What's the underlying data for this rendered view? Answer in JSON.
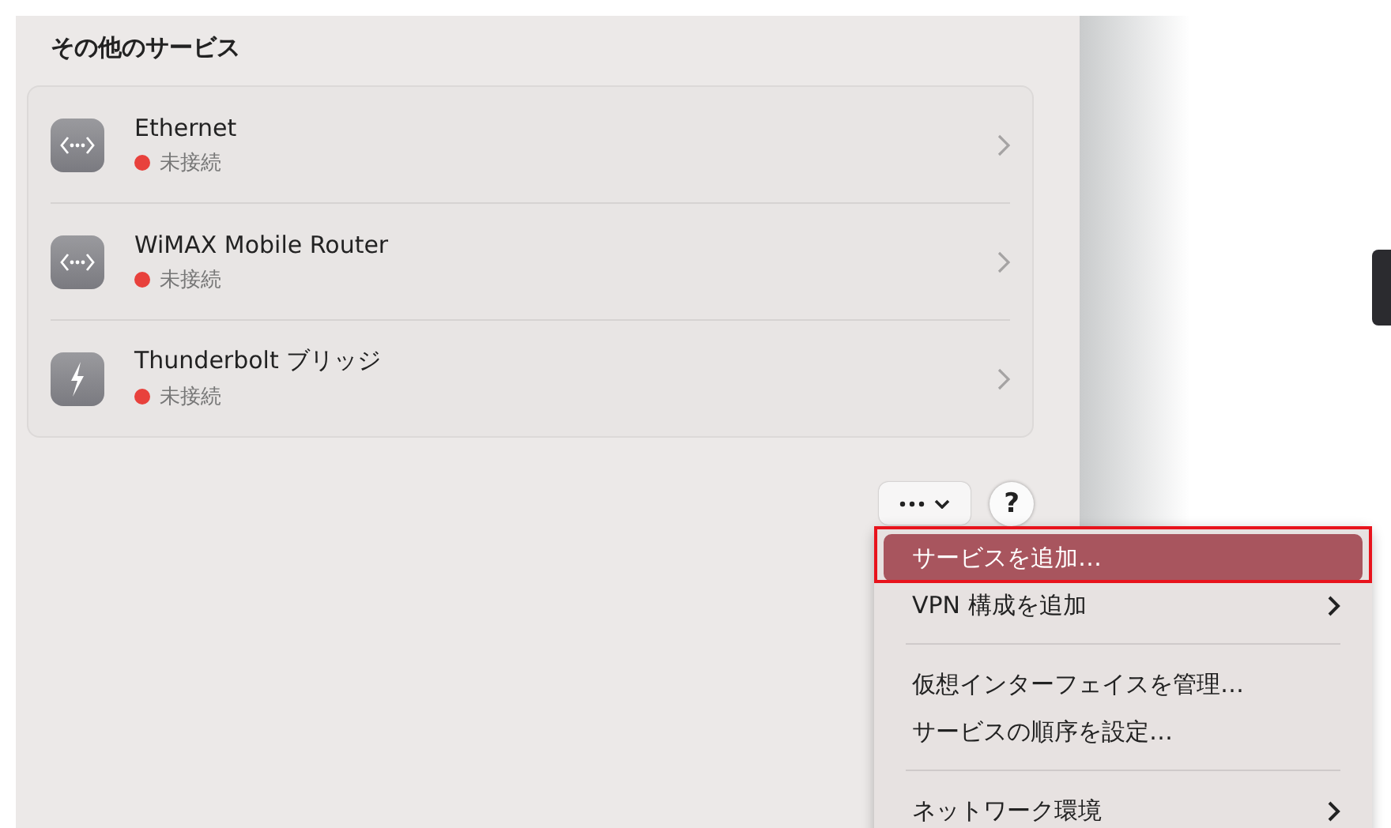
{
  "section_title": "その他のサービス",
  "services": [
    {
      "name": "Ethernet",
      "kind": "ethernet",
      "status": "未接続",
      "color": "#e8413c"
    },
    {
      "name": "WiMAX Mobile Router",
      "kind": "ethernet",
      "status": "未接続",
      "color": "#e8413c"
    },
    {
      "name": "Thunderbolt ブリッジ",
      "kind": "thunderbolt",
      "status": "未接続",
      "color": "#e8413c"
    }
  ],
  "help_button": "?",
  "menu": [
    {
      "kind": "item",
      "label": "サービスを追加…",
      "selected": true,
      "submenu": false
    },
    {
      "kind": "item",
      "label": "VPN 構成を追加",
      "selected": false,
      "submenu": true
    },
    {
      "kind": "separator"
    },
    {
      "kind": "item",
      "label": "仮想インターフェイスを管理…",
      "selected": false,
      "submenu": false
    },
    {
      "kind": "item",
      "label": "サービスの順序を設定…",
      "selected": false,
      "submenu": false
    },
    {
      "kind": "separator"
    },
    {
      "kind": "item",
      "label": "ネットワーク環境",
      "selected": false,
      "submenu": true
    }
  ]
}
